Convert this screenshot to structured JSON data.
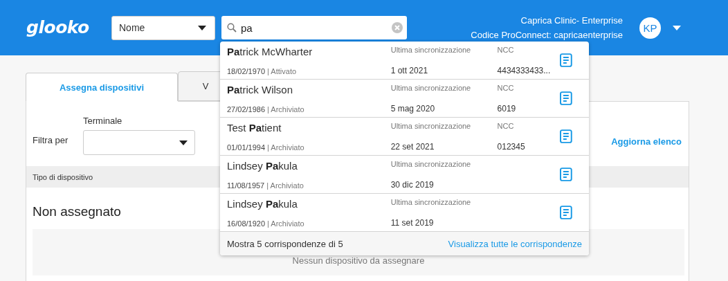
{
  "header": {
    "logo": "glooko",
    "search_by": {
      "value": "Nome"
    },
    "search": {
      "value": "pa"
    },
    "clinic": "Caprica Clinic- Enterprise",
    "code": "Codice ProConnect: capricaenterprise",
    "avatar": "KP"
  },
  "tabs": [
    {
      "label": "Assegna dispositivi",
      "selected": true
    },
    {
      "label": "V",
      "selected": false
    }
  ],
  "filter": {
    "label": "Filtra per",
    "field_label": "Terminale",
    "refresh": "Aggiorna elenco"
  },
  "table": {
    "column": "Tipo di dispositivo"
  },
  "section": {
    "title": "Non assegnato",
    "empty": "Nessun dispositivo da assegnare"
  },
  "results": {
    "items": [
      {
        "name": "**Pa**trick McWharter",
        "birth": "18/02/1970",
        "status": "| Attivato",
        "sync_label": "Ultima sincronizzazione",
        "sync": "1 ott 2021",
        "ncc_label": "NCC",
        "ncc": "4434333433..."
      },
      {
        "name": "**Pa**trick Wilson",
        "birth": "27/02/1986",
        "status": "| Archiviato",
        "sync_label": "Ultima sincronizzazione",
        "sync": "5 mag 2020",
        "ncc_label": "NCC",
        "ncc": "6019"
      },
      {
        "name": "Test **Pa**tient",
        "birth": "01/01/1994",
        "status": "| Archiviato",
        "sync_label": "Ultima sincronizzazione",
        "sync": "22 set 2021",
        "ncc_label": "NCC",
        "ncc": "012345"
      },
      {
        "name": "Lindsey **Pa**kula",
        "birth": "11/08/1957",
        "status": "| Archiviato",
        "sync_label": "Ultima sincronizzazione",
        "sync": "30 dic 2019"
      },
      {
        "name": "Lindsey **Pa**kula",
        "birth": "16/08/1920",
        "status": "| Archiviato",
        "sync_label": "Ultima sincronizzazione",
        "sync": "11 set 2019"
      }
    ],
    "count": "Mostra 5 corrispondenze di 5",
    "view_all": "Visualizza tutte le corrispondenze"
  }
}
